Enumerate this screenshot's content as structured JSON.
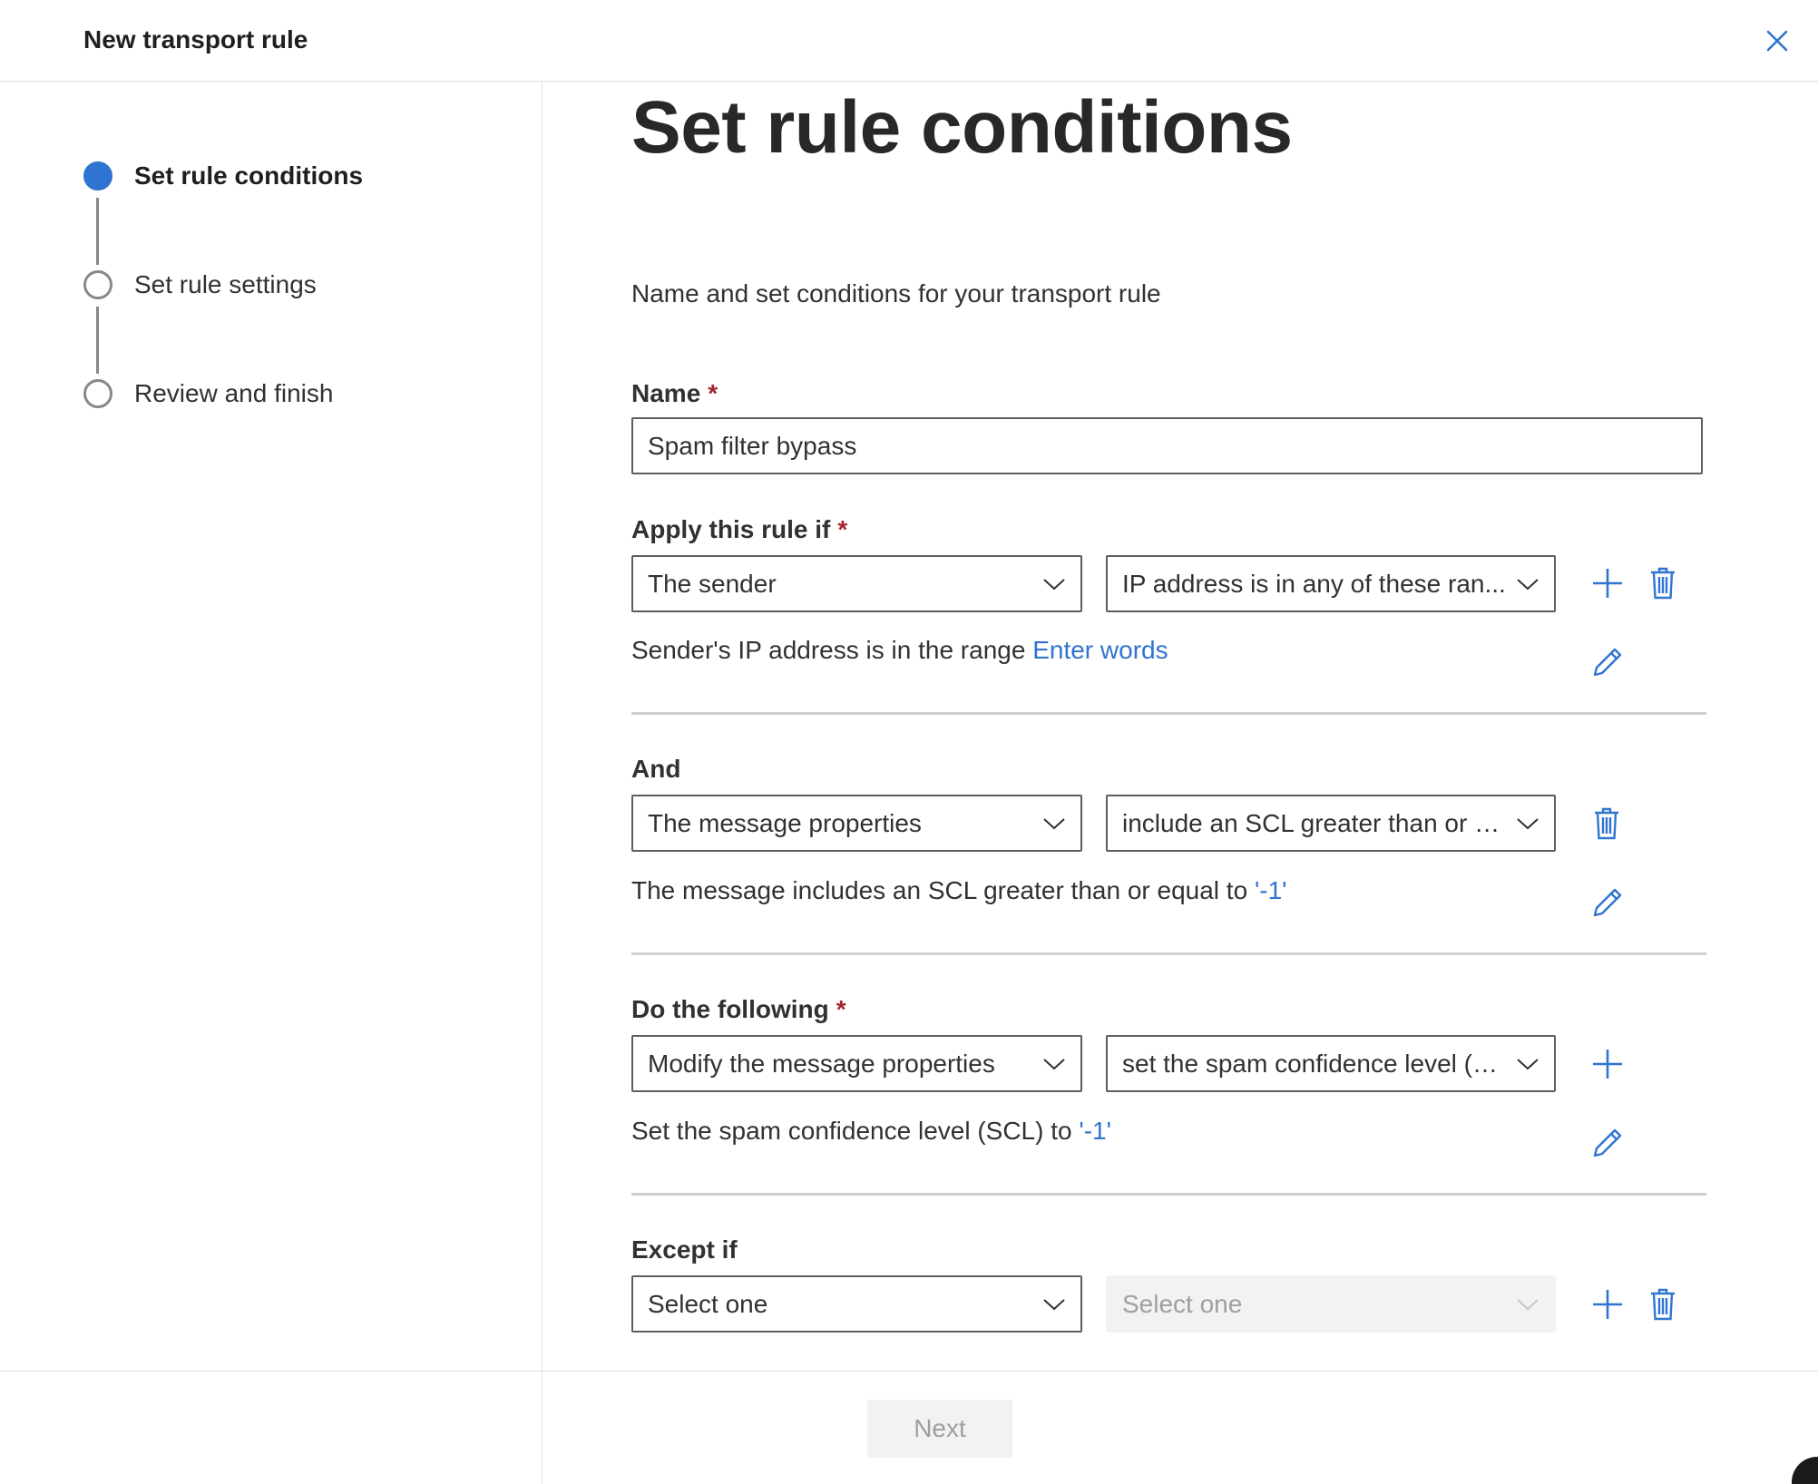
{
  "header": {
    "title": "New transport rule"
  },
  "steps": [
    {
      "label": "Set rule conditions",
      "active": true
    },
    {
      "label": "Set rule settings",
      "active": false
    },
    {
      "label": "Review and finish",
      "active": false
    }
  ],
  "main": {
    "title": "Set rule conditions",
    "subtitle": "Name and set conditions for your transport rule",
    "name_field": {
      "label": "Name",
      "required_mark": "*",
      "value": "Spam filter bypass"
    },
    "apply_if": {
      "label": "Apply this rule if",
      "required_mark": "*",
      "dropdown1": "The sender",
      "dropdown2": "IP address is in any of these ran...",
      "desc_text": "Sender's IP address is in the range ",
      "desc_link": "Enter words"
    },
    "and": {
      "label": "And",
      "dropdown1": "The message properties",
      "dropdown2": "include an SCL greater than or e...",
      "desc_text": "The message includes an SCL greater than or equal to ",
      "desc_link": "'-1'"
    },
    "do_following": {
      "label": "Do the following",
      "required_mark": "*",
      "dropdown1": "Modify the message properties",
      "dropdown2": "set the spam confidence level (S...",
      "desc_text": "Set the spam confidence level (SCL) to ",
      "desc_link": "'-1'"
    },
    "except_if": {
      "label": "Except if",
      "dropdown1": "Select one",
      "dropdown2": "Select one"
    }
  },
  "footer": {
    "next_label": "Next"
  },
  "colors": {
    "accent": "#2f74d0",
    "required": "#a4262c",
    "border": "#605e5c",
    "disabled_bg": "#f3f2f1"
  },
  "icons": [
    "close-icon",
    "chevron-down-icon",
    "add-icon",
    "delete-icon",
    "edit-icon"
  ]
}
